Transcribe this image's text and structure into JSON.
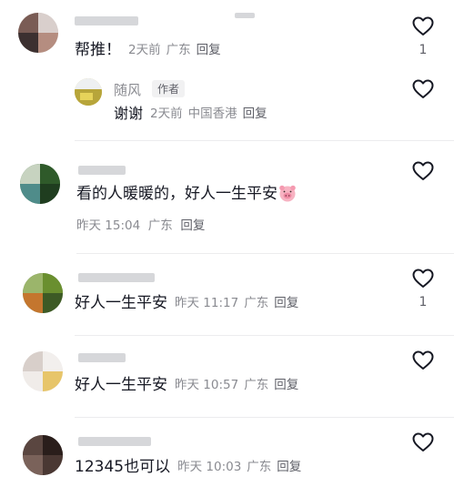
{
  "comments": [
    {
      "text": "帮推！",
      "time": "2天前",
      "location": "广东",
      "reply_label": "回复",
      "likes": "1",
      "reply": {
        "author": "随风",
        "badge": "作者",
        "text": "谢谢",
        "time": "2天前",
        "location": "中国香港",
        "reply_label": "回复"
      }
    },
    {
      "text": "看的人暖暖的，好人一生平安",
      "emoji": "pig-face-emoji",
      "time": "昨天 15:04",
      "location": "广东",
      "reply_label": "回复",
      "likes": ""
    },
    {
      "text": "好人一生平安",
      "time": "昨天 11:17",
      "location": "广东",
      "reply_label": "回复",
      "likes": "1"
    },
    {
      "text": "好人一生平安",
      "time": "昨天 10:57",
      "location": "广东",
      "reply_label": "回复",
      "likes": ""
    },
    {
      "text": "12345也可以",
      "time": "昨天 10:03",
      "location": "广东",
      "reply_label": "回复",
      "likes": ""
    }
  ],
  "icons": {
    "like": "heart-outline-icon"
  },
  "colors": {
    "text": "#161823",
    "meta": "#8a8b91",
    "reply": "#5f6068"
  }
}
